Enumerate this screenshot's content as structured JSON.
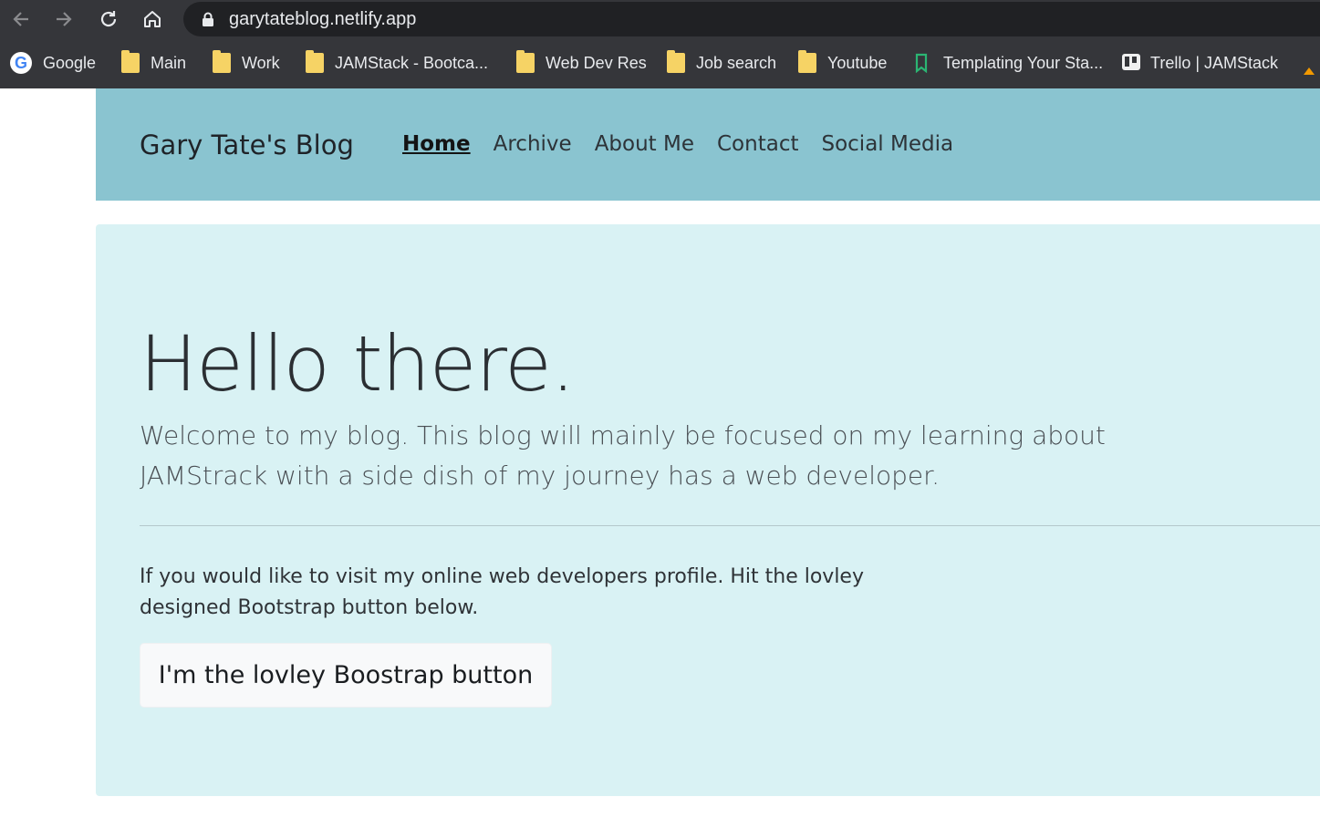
{
  "browser": {
    "url": "garytateblog.netlify.app",
    "bookmarks": [
      {
        "label": "Google",
        "icon": "google-icon"
      },
      {
        "label": "Main",
        "icon": "folder-icon"
      },
      {
        "label": "Work",
        "icon": "folder-icon"
      },
      {
        "label": "JAMStack - Bootca...",
        "icon": "folder-icon"
      },
      {
        "label": "Web Dev Res",
        "icon": "folder-icon"
      },
      {
        "label": "Job search",
        "icon": "folder-icon"
      },
      {
        "label": "Youtube",
        "icon": "folder-icon"
      },
      {
        "label": "Templating Your Sta...",
        "icon": "bookmark-page-icon"
      },
      {
        "label": "Trello | JAMStack",
        "icon": "trello-icon"
      }
    ]
  },
  "site": {
    "brand": "Gary Tate's Blog",
    "nav": [
      {
        "label": "Home",
        "active": true
      },
      {
        "label": "Archive",
        "active": false
      },
      {
        "label": "About Me",
        "active": false
      },
      {
        "label": "Contact",
        "active": false
      },
      {
        "label": "Social Media",
        "active": false
      }
    ]
  },
  "hero": {
    "heading": "Hello there.",
    "lead": "Welcome to my blog. This blog will mainly be focused on my learning about JAMStrack with a side dish of my journey has a web developer.",
    "paragraph": "If you would like to visit my online web developers profile. Hit the lovley designed Bootstrap button below.",
    "button_label": "I'm the lovley Boostrap button"
  },
  "colors": {
    "chrome": "#35363a",
    "navbar": "#8ac4d0",
    "jumbotron": "#d9f2f4"
  }
}
